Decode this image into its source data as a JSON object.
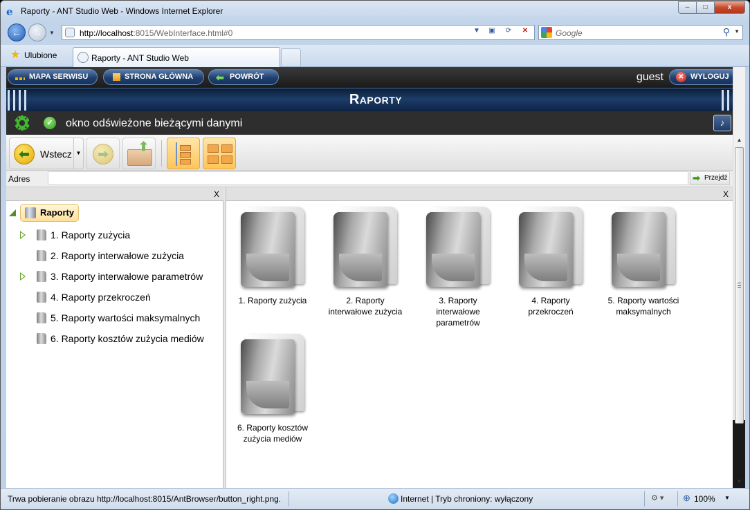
{
  "window": {
    "title": "Raporty - ANT Studio Web - Windows Internet Explorer",
    "controls": {
      "minimize": "–",
      "maximize": "□",
      "close": "x"
    }
  },
  "browser": {
    "back_icon": "←",
    "url_host": "http://localhost",
    "url_rest": ":8015/WebInterface.html#0",
    "search_placeholder": "Google",
    "search_icon": "⚲",
    "favorites_label": "Ulubione",
    "tab_label": "Raporty - ANT Studio Web",
    "status_text": "Trwa pobieranie obrazu http://localhost:8015/AntBrowser/button_right.png.",
    "zone_text": "Internet | Tryb chroniony: wyłączony",
    "zoom_text": "100%"
  },
  "app": {
    "nav": {
      "site_map": "MAPA SERWISU",
      "home": "STRONA GŁÓWNA",
      "back": "POWRÓT"
    },
    "user": "guest",
    "logout": "WYLOGUJ",
    "header_title": "Raporty",
    "status_message": "okno odświeżone bieżącymi danymi"
  },
  "explorer": {
    "toolbar": {
      "back_label": "Wstecz"
    },
    "address_label": "Adres",
    "address_value": "",
    "go_label": "Przejdź",
    "pane_close": "X",
    "tree": {
      "root": "Raporty",
      "items": [
        {
          "label": "1. Raporty zużycia",
          "expandable": true
        },
        {
          "label": "2. Raporty interwałowe zużycia",
          "expandable": false
        },
        {
          "label": "3. Raporty interwałowe parametrów",
          "expandable": true
        },
        {
          "label": "4. Raporty przekroczeń",
          "expandable": false
        },
        {
          "label": "5. Raporty wartości maksymalnych",
          "expandable": false
        },
        {
          "label": "6. Raporty kosztów zużycia mediów",
          "expandable": false
        }
      ]
    },
    "folders": [
      {
        "line1": "1. Raporty zużycia",
        "line2": "",
        "line3": ""
      },
      {
        "line1": "2. Raporty",
        "line2": "interwałowe zużycia",
        "line3": ""
      },
      {
        "line1": "3. Raporty",
        "line2": "interwałowe",
        "line3": "parametrów"
      },
      {
        "line1": "4. Raporty",
        "line2": "przekroczeń",
        "line3": ""
      },
      {
        "line1": "5. Raporty wartości",
        "line2": "maksymalnych",
        "line3": ""
      },
      {
        "line1": "6. Raporty kosztów",
        "line2": "zużycia mediów",
        "line3": ""
      }
    ]
  }
}
